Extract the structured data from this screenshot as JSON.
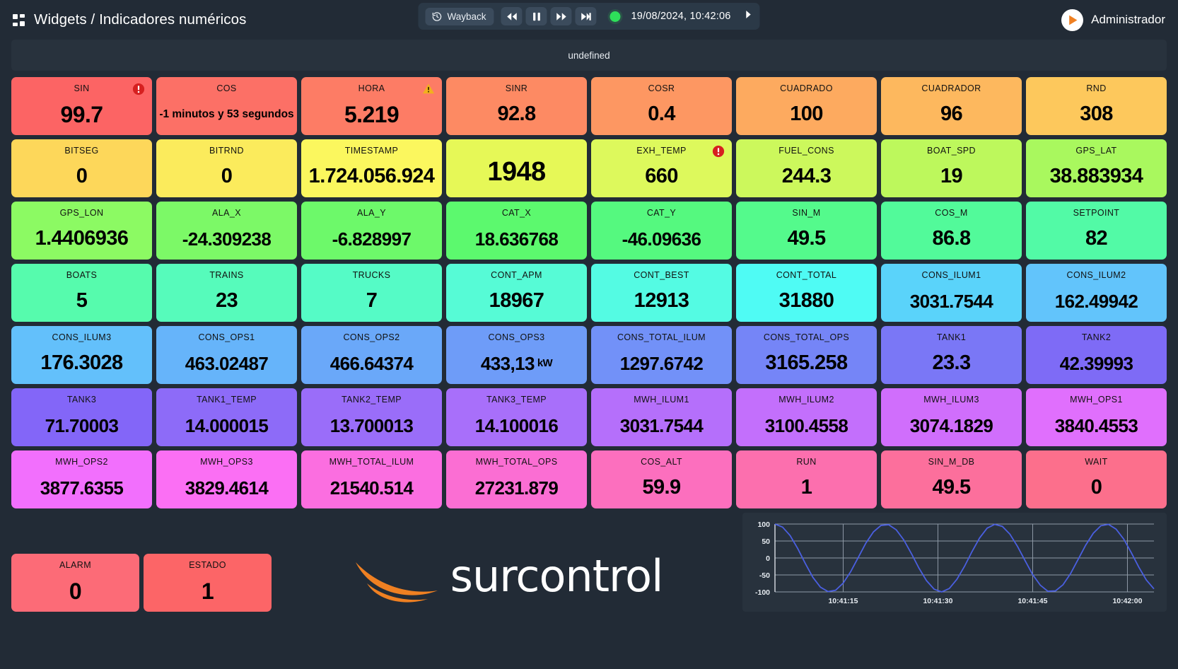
{
  "header": {
    "title": "Widgets / Indicadores numéricos",
    "menu_icon": "grid-icon",
    "wayback_label": "Wayback",
    "timestamp": "19/08/2024, 10:42:06",
    "user_name": "Administrador",
    "live_status_color": "#2ee05a",
    "controls": [
      "rewind",
      "pause",
      "forward",
      "skip-end"
    ]
  },
  "panel": {
    "title": "undefined"
  },
  "cards": [
    {
      "title": "SIN",
      "value": "99.7",
      "color": "#fc6464",
      "badge": "alarm"
    },
    {
      "title": "COS",
      "value": "-1 minutos y 53 segundos",
      "color": "#fc7066",
      "size": "small"
    },
    {
      "title": "HORA",
      "value": "5.219",
      "color": "#fd7c65",
      "badge": "warning"
    },
    {
      "title": "SINR",
      "value": "92.8",
      "color": "#fd8a63",
      "size": "fit"
    },
    {
      "title": "COSR",
      "value": "0.4",
      "color": "#fd9762",
      "size": "fit"
    },
    {
      "title": "CUADRADO",
      "value": "100",
      "color": "#fdaa5f",
      "size": "fit"
    },
    {
      "title": "CUADRADOR",
      "value": "96",
      "color": "#fdb85e",
      "size": "fit"
    },
    {
      "title": "RND",
      "value": "308",
      "color": "#fdc85c",
      "size": "fit"
    },
    {
      "title": "BITSEG",
      "value": "0",
      "color": "#fdd75a",
      "size": "fit"
    },
    {
      "title": "BITRND",
      "value": "0",
      "color": "#fbeb5c",
      "size": "fit"
    },
    {
      "title": "TIMESTAMP",
      "value": "1.724.056.924",
      "color": "#fbf75e",
      "size": "fit"
    },
    {
      "title": "",
      "value": "1948",
      "color": "#e6f857",
      "size": "notitle"
    },
    {
      "title": "EXH_TEMP",
      "value": "660",
      "color": "#ddf95c",
      "badge": "alarm",
      "size": "fit"
    },
    {
      "title": "FUEL_CONS",
      "value": "244.3",
      "color": "#ccf85c",
      "size": "fit"
    },
    {
      "title": "BOAT_SPD",
      "value": "19",
      "color": "#bdf85c",
      "size": "fit"
    },
    {
      "title": "GPS_LAT",
      "value": "38.883934",
      "color": "#a9f85e",
      "size": "fit"
    },
    {
      "title": "GPS_LON",
      "value": "1.4406936",
      "color": "#8cfa63",
      "size": "fit"
    },
    {
      "title": "ALA_X",
      "value": "-24.309238",
      "color": "#7cf967",
      "size": "fit2"
    },
    {
      "title": "ALA_Y",
      "value": "-6.828997",
      "color": "#6df96a",
      "size": "fit2"
    },
    {
      "title": "CAT_X",
      "value": "18.636768",
      "color": "#5cf96e",
      "size": "fit2"
    },
    {
      "title": "CAT_Y",
      "value": "-46.09636",
      "color": "#55f97f",
      "size": "fit2"
    },
    {
      "title": "SIN_M",
      "value": "49.5",
      "color": "#54fa8c",
      "size": "fit"
    },
    {
      "title": "COS_M",
      "value": "86.8",
      "color": "#52fa9a",
      "size": "fit"
    },
    {
      "title": "SETPOINT",
      "value": "82",
      "color": "#52faa6",
      "size": "fit"
    },
    {
      "title": "BOATS",
      "value": "5",
      "color": "#56fbad",
      "size": "fit"
    },
    {
      "title": "TRAINS",
      "value": "23",
      "color": "#56fbbb",
      "size": "fit"
    },
    {
      "title": "TRUCKS",
      "value": "7",
      "color": "#55fbc6",
      "size": "fit"
    },
    {
      "title": "CONT_APM",
      "value": "18967",
      "color": "#56fbd6",
      "size": "fit"
    },
    {
      "title": "CONT_BEST",
      "value": "12913",
      "color": "#54fbe3",
      "size": "fit"
    },
    {
      "title": "CONT_TOTAL",
      "value": "31880",
      "color": "#4ffbf4",
      "size": "fit"
    },
    {
      "title": "CONS_ILUM1",
      "value": "3031.7544",
      "color": "#5ad3fa",
      "size": "fit2"
    },
    {
      "title": "CONS_ILUM2",
      "value": "162.49942",
      "color": "#62c4fb",
      "size": "fit2"
    },
    {
      "title": "CONS_ILUM3",
      "value": "176.3028",
      "color": "#63c0fb",
      "size": "fit"
    },
    {
      "title": "CONS_OPS1",
      "value": "463.02487",
      "color": "#66b4fa",
      "size": "fit2"
    },
    {
      "title": "CONS_OPS2",
      "value": "466.64374",
      "color": "#6aa8f9",
      "size": "fit2"
    },
    {
      "title": "CONS_OPS3",
      "value": "433,13",
      "unit": "kW",
      "color": "#6e9cf8",
      "size": "fit2"
    },
    {
      "title": "CONS_TOTAL_ILUM",
      "value": "1297.6742",
      "color": "#7291f8",
      "size": "fit2"
    },
    {
      "title": "CONS_TOTAL_OPS",
      "value": "3165.258",
      "color": "#7585f7",
      "size": "fit"
    },
    {
      "title": "TANK1",
      "value": "23.3",
      "color": "#7a77f6",
      "size": "fit"
    },
    {
      "title": "TANK2",
      "value": "42.39993",
      "color": "#7e6bf6",
      "size": "fit2"
    },
    {
      "title": "TANK3",
      "value": "71.70003",
      "color": "#8366f8",
      "size": "fit2"
    },
    {
      "title": "TANK1_TEMP",
      "value": "14.000015",
      "color": "#8d6bf8",
      "size": "fit2"
    },
    {
      "title": "TANK2_TEMP",
      "value": "13.700013",
      "color": "#9a6df9",
      "size": "fit2"
    },
    {
      "title": "TANK3_TEMP",
      "value": "14.100016",
      "color": "#a86ffa",
      "size": "fit2"
    },
    {
      "title": "MWH_ILUM1",
      "value": "3031.7544",
      "color": "#b56ffb",
      "size": "fit2"
    },
    {
      "title": "MWH_ILUM2",
      "value": "3100.4558",
      "color": "#c36ffc",
      "size": "fit2"
    },
    {
      "title": "MWH_ILUM3",
      "value": "3074.1829",
      "color": "#d06efc",
      "size": "fit2"
    },
    {
      "title": "MWH_OPS1",
      "value": "3840.4553",
      "color": "#e06ffd",
      "size": "fit2"
    },
    {
      "title": "MWH_OPS2",
      "value": "3877.6355",
      "color": "#f26ffd",
      "size": "fit2"
    },
    {
      "title": "MWH_OPS3",
      "value": "3829.4614",
      "color": "#fb6ff4",
      "size": "fit2"
    },
    {
      "title": "MWH_TOTAL_ILUM",
      "value": "21540.514",
      "color": "#fb6ee0",
      "size": "fit2"
    },
    {
      "title": "MWH_TOTAL_OPS",
      "value": "27231.879",
      "color": "#fb6ed3",
      "size": "fit2"
    },
    {
      "title": "COS_ALT",
      "value": "59.9",
      "color": "#fc6fbe",
      "size": "fit"
    },
    {
      "title": "RUN",
      "value": "1",
      "color": "#fc6fae",
      "size": "fit"
    },
    {
      "title": "SIN_M_DB",
      "value": "49.5",
      "color": "#fc6f9c",
      "size": "fit"
    },
    {
      "title": "WAIT",
      "value": "0",
      "color": "#fc6f8c",
      "size": "fit"
    }
  ],
  "footer_cards": [
    {
      "title": "ALARM",
      "value": "0",
      "color": "#fc6b77"
    },
    {
      "title": "ESTADO",
      "value": "1",
      "color": "#fc6567"
    }
  ],
  "logo": {
    "text": "surcontrol",
    "accent": "#ef8022"
  },
  "chart_data": {
    "type": "line",
    "title": "",
    "xlabel": "",
    "ylabel": "",
    "ylim": [
      -100,
      100
    ],
    "yticks": [
      100,
      50,
      0,
      -50,
      -100
    ],
    "ytick_labels": [
      "100",
      "50",
      "0",
      "-50",
      "-100"
    ],
    "xtick_labels": [
      "10:41:15",
      "10:41:30",
      "10:41:45",
      "10:42:00"
    ],
    "grid": true,
    "legend": "none",
    "series": [
      {
        "name": "SIN",
        "color": "#4a5fe0",
        "comment": "cosine-like wave, amplitude 100, about 2.6 periods across window",
        "x": [
          0,
          2,
          4,
          6,
          8,
          10,
          12,
          14,
          16,
          18,
          20,
          22,
          24,
          26,
          28,
          30,
          32,
          34,
          36,
          38,
          40,
          42,
          44,
          46,
          48,
          50,
          52,
          54,
          56,
          58,
          60,
          62,
          64,
          66,
          68,
          70,
          72,
          74,
          76,
          78,
          80,
          82,
          84,
          86,
          88,
          90,
          92,
          94,
          96,
          98,
          100
        ],
        "y": [
          100,
          91,
          66,
          28,
          -16,
          -57,
          -86,
          -99,
          -95,
          -74,
          -40,
          2,
          44,
          77,
          96,
          98,
          83,
          53,
          13,
          -30,
          -67,
          -92,
          -100,
          -90,
          -63,
          -25,
          19,
          59,
          88,
          99,
          93,
          70,
          34,
          -8,
          -49,
          -80,
          -98,
          -97,
          -79,
          -46,
          -4,
          38,
          73,
          95,
          99,
          85,
          56,
          16,
          -27,
          -65,
          -91
        ]
      }
    ]
  }
}
